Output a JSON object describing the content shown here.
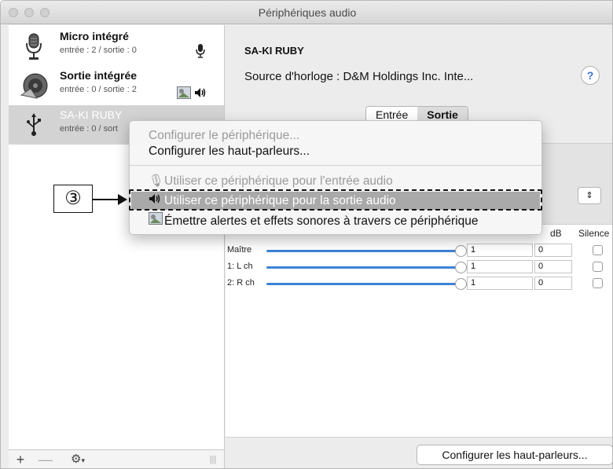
{
  "window": {
    "title": "Périphériques audio"
  },
  "devices": [
    {
      "name": "Micro intégré",
      "sub": "entrée : 2 / sortie : 0",
      "icon": "microphone-icon",
      "badges": [
        "mic-badge-icon"
      ]
    },
    {
      "name": "Sortie intégrée",
      "sub": "entrée : 0 / sortie : 2",
      "icon": "speaker-icon",
      "badges": [
        "alert-sound-icon",
        "output-speaker-badge-icon"
      ]
    },
    {
      "name": "SA-KI RUBY",
      "sub": "entrée : 0 / sort",
      "icon": "usb-icon",
      "badges": []
    }
  ],
  "sidebar_toolbar": {
    "add": "+",
    "remove": "—",
    "gear": "⚙"
  },
  "detail": {
    "device_title": "SA-KI RUBY",
    "clock_source": "Source d'horloge :  D&M Holdings Inc. Inte...",
    "help": "?",
    "tabs": [
      "Entrée",
      "Sortie"
    ],
    "active_tab": "Sortie",
    "columns": {
      "db": "dB",
      "silence": "Silence"
    },
    "channels": [
      {
        "label": "Maître",
        "value": "1",
        "db": "0",
        "level": 1.0
      },
      {
        "label": "1: L ch",
        "value": "1",
        "db": "0",
        "level": 1.0
      },
      {
        "label": "2: R ch",
        "value": "1",
        "db": "0",
        "level": 1.0
      }
    ],
    "configure_speakers_button": "Configurer les haut-parleurs..."
  },
  "context_menu": {
    "items": [
      {
        "label": "Configurer le périphérique...",
        "enabled": false
      },
      {
        "label": "Configurer les haut-parleurs...",
        "enabled": true
      },
      {
        "label": "Utiliser ce périphérique pour l'entrée audio",
        "enabled": false,
        "icon": "microphone-icon"
      },
      {
        "label": "Utiliser ce périphérique pour la sortie audio",
        "enabled": true,
        "highlighted": true,
        "icon": "speaker-output-icon"
      },
      {
        "label": "Émettre alertes et effets sonores à travers ce périphérique",
        "enabled": true,
        "icon": "alert-sound-icon"
      }
    ]
  },
  "callout": {
    "number": "③"
  },
  "colors": {
    "slider": "#3d82d8",
    "highlight": "#a9a9a9",
    "help": "#3a6fd8"
  }
}
